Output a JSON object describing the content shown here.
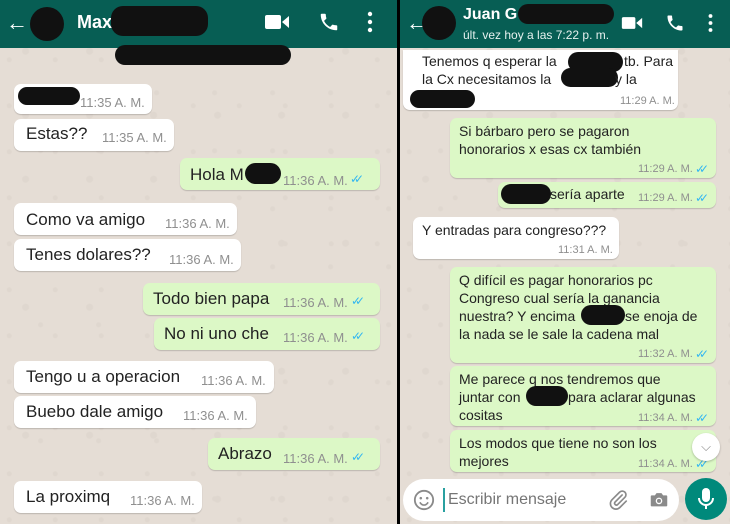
{
  "left": {
    "header": {
      "back": "←",
      "name": "Max"
    },
    "messages": [
      {
        "text": "",
        "time": "11:35 A. M."
      },
      {
        "text": "Estas??",
        "time": "11:35 A. M."
      },
      {
        "text": "Hola M",
        "time": "11:36 A. M.",
        "ticks": "✓✓"
      },
      {
        "text": "Como va amigo",
        "time": "11:36 A. M."
      },
      {
        "text": "Tenes dolares??",
        "time": "11:36 A. M."
      },
      {
        "text": "Todo bien papa",
        "time": "11:36 A. M.",
        "ticks": "✓✓"
      },
      {
        "text": "No ni uno che",
        "time": "11:36 A. M.",
        "ticks": "✓✓"
      },
      {
        "text": "Tengo u a operacion",
        "time": "11:36 A. M."
      },
      {
        "text": "Buebo dale amigo",
        "time": "11:36 A. M."
      },
      {
        "text": "Abrazo",
        "time": "11:36 A. M.",
        "ticks": "✓✓"
      },
      {
        "text": "La proximq",
        "time": "11:36 A. M."
      }
    ]
  },
  "right": {
    "header": {
      "back": "←",
      "name": "Juan G",
      "status": "últ. vez hoy a las 7:22 p. m."
    },
    "messages": [
      {
        "lines": [
          "Tenemos q esperar la",
          "tb. Para",
          "la Cx necesitamos la",
          "y la"
        ],
        "time": "11:29 A. M."
      },
      {
        "lines": [
          "Si bárbaro pero se pagaron",
          "honorarios x esas cx también"
        ],
        "time": "11:29 A. M.",
        "ticks": "✓✓"
      },
      {
        "lines": [
          "sería aparte"
        ],
        "time": "11:29 A. M.",
        "ticks": "✓✓"
      },
      {
        "lines": [
          "Y entradas para congreso???"
        ],
        "time": "11:31 A. M."
      },
      {
        "lines": [
          "Q difícil es pagar honorarios  pc",
          "Congreso cual sería la ganancia",
          "nuestra? Y encima",
          "se enoja de",
          "la nada se le sale la cadena mal"
        ],
        "time": "11:32 A. M.",
        "ticks": "✓✓"
      },
      {
        "lines": [
          "Me parece q nos tendremos que",
          "juntar con",
          "para aclarar algunas",
          "cositas"
        ],
        "time": "11:34 A. M.",
        "ticks": "✓✓"
      },
      {
        "lines": [
          "Los modos que tiene no son los",
          "mejores"
        ],
        "time": "11:34 A. M.",
        "ticks": "✓✓"
      }
    ],
    "input": {
      "placeholder": "Escribir mensaje"
    }
  },
  "colors": {
    "header": "#075e54",
    "outgoing_bubble": "#dcf8c6",
    "incoming_bubble": "#ffffff",
    "chat_background": "#e5ddd5",
    "read_ticks": "#34b7f1",
    "mic_button": "#00897b"
  },
  "icons": [
    "back-arrow-icon",
    "video-call-icon",
    "phone-icon",
    "more-options-icon",
    "emoji-icon",
    "attach-icon",
    "camera-icon",
    "mic-icon",
    "scroll-down-icon",
    "read-ticks-icon"
  ]
}
